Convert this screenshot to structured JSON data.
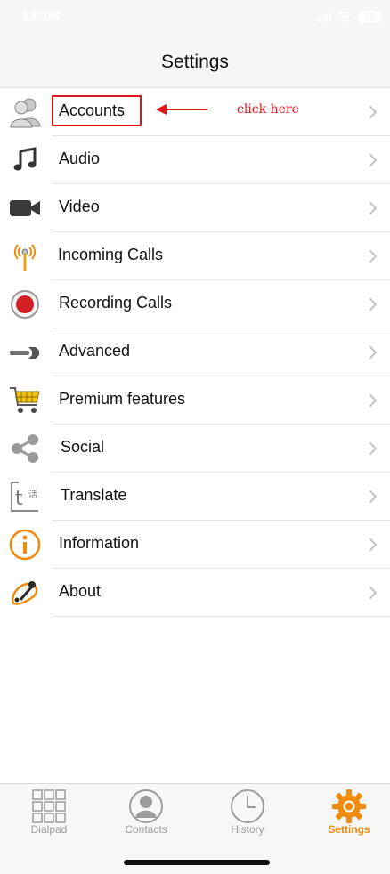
{
  "status_bar": {
    "time": "12:09",
    "battery": "75"
  },
  "header": {
    "title": "Settings"
  },
  "settings": {
    "items": [
      {
        "label": "Accounts",
        "icon": "accounts-icon"
      },
      {
        "label": "Audio",
        "icon": "music-note-icon"
      },
      {
        "label": "Video",
        "icon": "video-camera-icon"
      },
      {
        "label": "Incoming Calls",
        "icon": "antenna-icon"
      },
      {
        "label": "Recording Calls",
        "icon": "record-icon"
      },
      {
        "label": "Advanced",
        "icon": "wrench-icon"
      },
      {
        "label": "Premium features",
        "icon": "shopping-cart-icon"
      },
      {
        "label": "Social",
        "icon": "share-icon"
      },
      {
        "label": "Translate",
        "icon": "translate-icon"
      },
      {
        "label": "Information",
        "icon": "info-icon"
      },
      {
        "label": "About",
        "icon": "about-icon"
      }
    ]
  },
  "annotation": {
    "text": "click here",
    "color": "#e3131b"
  },
  "tabs": [
    {
      "label": "Dialpad",
      "icon": "dialpad-icon",
      "active": false
    },
    {
      "label": "Contacts",
      "icon": "contacts-icon",
      "active": false
    },
    {
      "label": "History",
      "icon": "clock-icon",
      "active": false
    },
    {
      "label": "Settings",
      "icon": "gear-icon",
      "active": true
    }
  ],
  "colors": {
    "accent": "#ef8b0d",
    "annotation": "#e3131b",
    "inactive_tab": "#9c9c9c"
  }
}
